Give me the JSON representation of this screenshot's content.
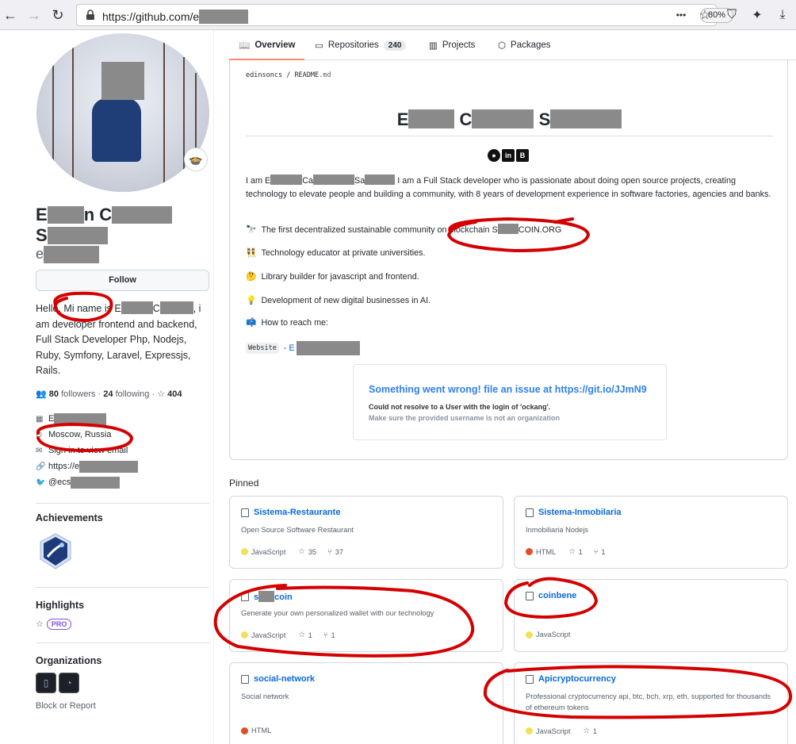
{
  "browser": {
    "url": "https://github.com/e",
    "zoom": "80%",
    "more_label": "•••"
  },
  "profile": {
    "name_line1_start": "E",
    "name_line1_mid": "n C",
    "name_line2": "S",
    "username": "e",
    "follow_label": "Follow",
    "bio_1": "Hello, Mi name is E",
    "bio_2": "C",
    "bio_3": ", i am developer frontend and backend, Full Stack Developer Php, Nodejs, Ruby, Symfony, Laravel, Expressjs, Rails.",
    "followers_count": "80",
    "followers_label": "followers",
    "following_count": "24",
    "following_label": "following",
    "stars_count": "404",
    "company": "E",
    "location": "Moscow, Russia",
    "email": "Sign in to view email",
    "website": "https://e",
    "twitter": "@ecs",
    "achievements_heading": "Achievements",
    "highlights_heading": "Highlights",
    "pro_label": "PRO",
    "organizations_heading": "Organizations",
    "block_report": "Block or Report"
  },
  "tabs": [
    {
      "label": "Overview"
    },
    {
      "label": "Repositories",
      "count": "240"
    },
    {
      "label": "Projects"
    },
    {
      "label": "Packages"
    }
  ],
  "readme": {
    "path_user": "edinsoncs",
    "path_sep": "/",
    "path_file": "README",
    "path_ext": ".md",
    "title_e": "E",
    "title_c": "C",
    "title_s": "S",
    "intro_1": "I am E",
    "intro_2": "Ca",
    "intro_3": "Sa",
    "intro_4": "I am a Full Stack developer who is passionate about doing open source projects, creating technology to elevate people and building a community, with 8 years of development experience in software factories, agencies and banks.",
    "line1": "The first decentralized sustainable community on blockchain S",
    "line1_end": "COIN.ORG",
    "line2": "Technology educator at private universities.",
    "line3": "Library builder for javascript and frontend.",
    "line4": "Development of new digital businesses in AI.",
    "line5": "How to reach me:",
    "website_chip": "Website",
    "website_dash": "- E",
    "error_title": "Something went wrong! file an issue at https://git.io/JJmN9",
    "error_line1": "Could not resolve to a User with the login of 'ockang'.",
    "error_line2": "Make sure the provided username is not an organization"
  },
  "pinned": {
    "heading": "Pinned",
    "repos": [
      {
        "name": "Sistema-Restaurante",
        "desc": "Open Source Software Restaurant",
        "lang": "JavaScript",
        "lang_color": "#f1e05a",
        "stars": "35",
        "forks": "37"
      },
      {
        "name": "Sistema-Inmobilaria",
        "desc": "Inmobiliaria Nodejs",
        "lang": "HTML",
        "lang_color": "#e34c26",
        "stars": "1",
        "forks": "1"
      },
      {
        "name_start": "s",
        "name_end": "coin",
        "desc": "Generate your own personalized wallet with our technology",
        "lang": "JavaScript",
        "lang_color": "#f1e05a",
        "stars": "1",
        "forks": "1"
      },
      {
        "name": "coinbene",
        "desc": "",
        "lang": "JavaScript",
        "lang_color": "#f1e05a"
      },
      {
        "name": "social-network",
        "desc": "Social network",
        "lang": "HTML",
        "lang_color": "#e34c26"
      },
      {
        "name": "Apicryptocurrency",
        "desc": "Professional cryptocurrency api, btc, bch, xrp, eth, supported for thousands of ethereum tokens",
        "lang": "JavaScript",
        "lang_color": "#f1e05a",
        "stars": "1"
      }
    ]
  },
  "colors": {
    "link": "#0969da",
    "annotation": "#d40000",
    "tab_underline": "#fd8c73"
  }
}
